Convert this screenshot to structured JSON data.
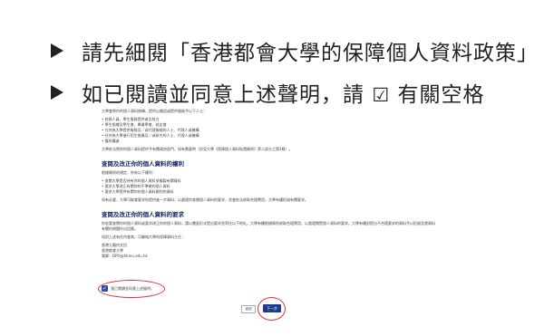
{
  "bullets": [
    {
      "text": "請先細閱「香港都會大學的保障個人資料政策」"
    },
    {
      "text_before": "如已閱讀並同意上述聲明，請",
      "checkbox_glyph": "☑",
      "text_after": "有關空格"
    }
  ],
  "doc": {
    "intro": "大學會將你的個人資料移轉，提供以開設或提供服務予以下人士：",
    "list1": [
      "• 校務人員、學生服務提供者及校方",
      "• 學生組織及學生會、畢業學會、校友會",
      "• 任何為大學提供服務及／或代理服務的人士、代理人或機構",
      "• 任何為大學進行招生推廣及／或研究的人士、代理人或機構",
      "• 獲授權者",
      "大學依法將你的個人資料提供予有關政府部門，如有需要時（詳見大學《保障個人資料私隱條例》第二部分之第2條）。"
    ],
    "heading1": "查閱及改正你的個人資料的權利",
    "sub1": "根據條例的規定，你有以下權利：",
    "list2": [
      "• 查閱大學是否持有你的個人資料並複製有關資料",
      "• 要求大學改正有關你的不準確的個人資料",
      "• 要求大學提供有關你的個人資料類別的資料"
    ],
    "note1": "如有必要，大學可能會要求你提供進一步資料，以處理你查閱個人資料的要求，並會依法收取合理費用，大學有權拒絕有關要求。",
    "heading2": "查閱及改正你的個人資料的要求",
    "para2": "你若要查閱你的個人資料或要求改正你的個人資料，請以書面形式提出要求並寄往以下地址。大學有權根據條例收取合理費用，以處理閱覽個人資料的要求。大學有權對提出不合理要求的資料予以拒絕及就資料有關的問題作出回應。",
    "contact_intro": "如對上述有任何查詢，可聯絡大學的保障資料主任：",
    "contact": [
      "香港九龍何文田",
      "香港都會大學",
      "電郵：DPO@hkmu.edu.hk"
    ],
    "agree_label": "我已閱讀並同意上述聲明。",
    "back_label": "返回",
    "next_label": "下一步"
  }
}
